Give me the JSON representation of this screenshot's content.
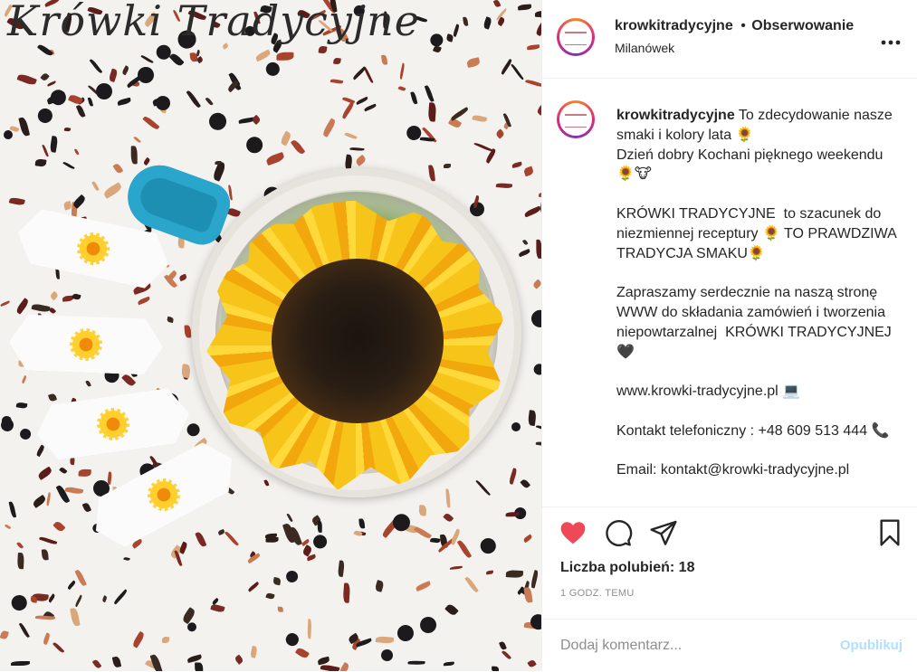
{
  "photo": {
    "overlay_title": "Krówki Tradycyjne"
  },
  "header": {
    "username": "krowkitradycyjne",
    "separator": "•",
    "follow_label": "Obserwowanie",
    "location": "Milanówek",
    "more_icon": "more-options-icon"
  },
  "caption": {
    "username": "krowkitradycyjne",
    "text": " To zdecydowanie nasze smaki i kolory lata 🌻\nDzień dobry Kochani pięknego weekendu 🌻🐮\n\nKRÓWKI TRADYCYJNE  to szacunek do niezmiennej receptury 🌻 TO PRAWDZIWA TRADYCJA SMAKU🌻\n\nZapraszamy serdecznie na naszą stronę WWW do składania zamówień i tworzenia niepowtarzalnej  KRÓWKI TRADYCYJNEJ 🖤\n\nwww.krowki-tradycyjne.pl 💻\n\nKontakt telefoniczny : +48 609 513 444 📞\n\nEmail: kontakt@krowki-tradycyjne.pl"
  },
  "actions": {
    "like_icon": "heart-icon",
    "comment_icon": "comment-icon",
    "share_icon": "share-icon",
    "save_icon": "bookmark-icon",
    "likes_label": "Liczba polubień: 18",
    "timestamp": "1 GODZ. TEMU"
  },
  "comment_box": {
    "placeholder": "Dodaj komentarz...",
    "publish_label": "Opublikuj"
  },
  "colors": {
    "like_red": "#ed4956",
    "publish_blue": "#b2dffc",
    "text": "#262626",
    "muted": "#8e8e8e"
  }
}
